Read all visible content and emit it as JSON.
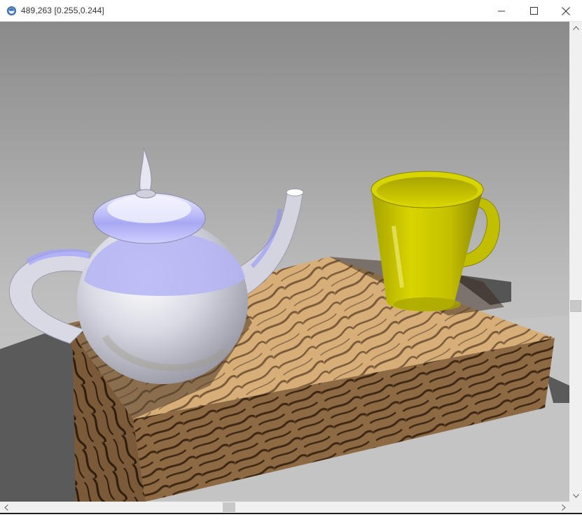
{
  "window": {
    "title": "489,263 [0.255,0.244]",
    "app_icon": "render-app-icon",
    "controls": [
      "minimize-icon",
      "maximize-icon",
      "close-icon"
    ]
  },
  "scene": {
    "description_objects": [
      "teapot",
      "mug",
      "wooden-block"
    ],
    "colors": {
      "teapot_highlight": "#b8b8ff",
      "teapot_body": "#e4e4ec",
      "mug": "#c8c400",
      "wood_light": "#d8b07c",
      "wood_grain": "#6a4a2c",
      "background": "#9a9a9a",
      "floor": "#bdbdbd",
      "shadow": "#555555"
    }
  },
  "scrollbars": {
    "vertical": {
      "position": 0.6
    },
    "horizontal": {
      "position": 0.4
    }
  }
}
